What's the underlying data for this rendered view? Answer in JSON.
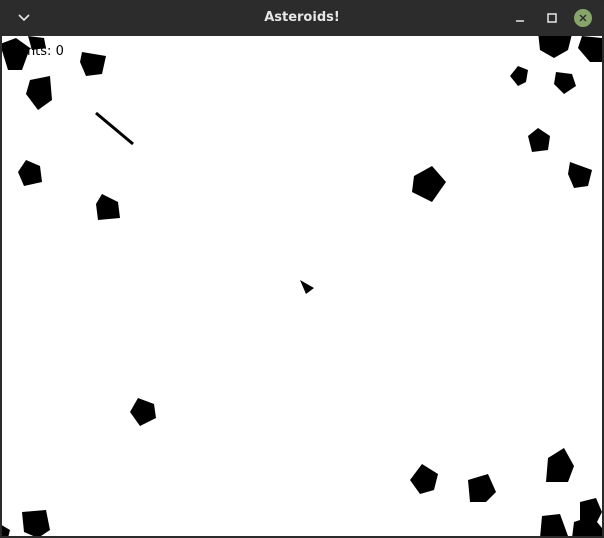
{
  "window": {
    "title": "Asteroids!"
  },
  "hud": {
    "points_label": "Points: 0"
  },
  "game": {
    "asteroid_count": 27,
    "bullet_count": 1,
    "ship_count": 1
  }
}
